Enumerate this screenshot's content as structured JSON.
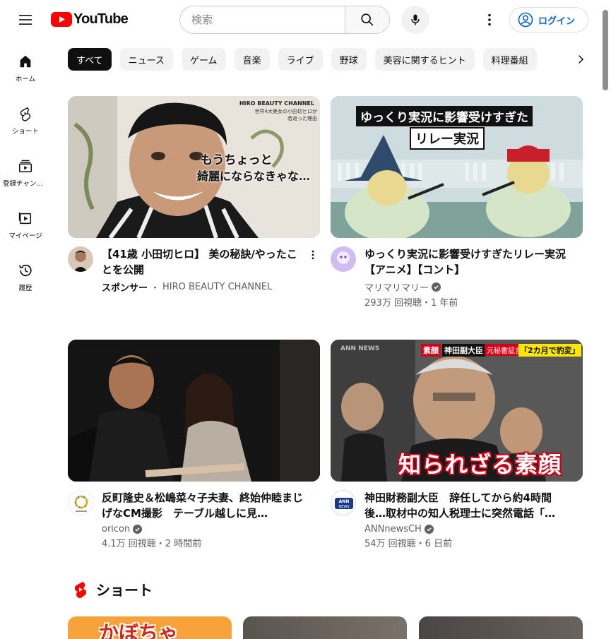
{
  "header": {
    "logo_text": "YouTube",
    "search_placeholder": "検索",
    "login_label": "ログイン"
  },
  "sidebar": {
    "items": [
      {
        "label": "ホーム",
        "icon": "home-icon"
      },
      {
        "label": "ショート",
        "icon": "shorts-icon"
      },
      {
        "label": "登録チャンネル",
        "icon": "subscriptions-icon"
      },
      {
        "label": "マイページ",
        "icon": "you-icon"
      },
      {
        "label": "履歴",
        "icon": "history-icon"
      }
    ]
  },
  "chips": [
    "すべて",
    "ニュース",
    "ゲーム",
    "音楽",
    "ライブ",
    "野球",
    "美容に関するヒント",
    "料理番組"
  ],
  "videos": [
    {
      "title": "【41歳 小田切ヒロ】 美の秘訣/やったことを公開",
      "channel_prefix": "スポンサー",
      "channel": "HIRO BEAUTY CHANNEL",
      "stats": "",
      "thumb_text_1": "HIRO BEAUTY CHANNEL",
      "thumb_text_2": "世界4大美女の小田切ヒロが",
      "thumb_text_3": "若返った理由",
      "thumb_caption_1": "もうちょっと",
      "thumb_caption_2": "綺麗にならなきゃな…"
    },
    {
      "title": "ゆっくり実況に影響受けすぎたリレー実況【アニメ】【コント】",
      "channel": "マリマリマリー",
      "stats": "293万 回視聴・1 年前",
      "thumb_caption_1": "ゆっくり実況に影響受けすぎた",
      "thumb_caption_2": "リレー実況"
    },
    {
      "title": "反町隆史＆松嶋菜々子夫妻、終始仲睦まじげなCM撮影　テーブル越しに見…",
      "channel": "oricon",
      "stats": "4.1万 回視聴・2 時間前"
    },
    {
      "title": "神田財務副大臣　辞任してから約4時間後…取材中の知人税理士に突然電話「…",
      "channel": "ANNnewsCH",
      "stats": "54万 回視聴・6 日前",
      "thumb_tag": "素顔",
      "thumb_header": "神田副大臣",
      "thumb_sub": "元秘書証言",
      "thumb_quote": "「2カ月で豹変」",
      "thumb_caption": "知られざる素顔",
      "thumb_logo": "ANN NEWS"
    }
  ],
  "shorts": {
    "title": "ショート",
    "first_thumb_text": "かぼちゃ"
  },
  "colors": {
    "brand_red": "#ff0000",
    "link_blue": "#065fd4",
    "secondary_text": "#606060"
  }
}
